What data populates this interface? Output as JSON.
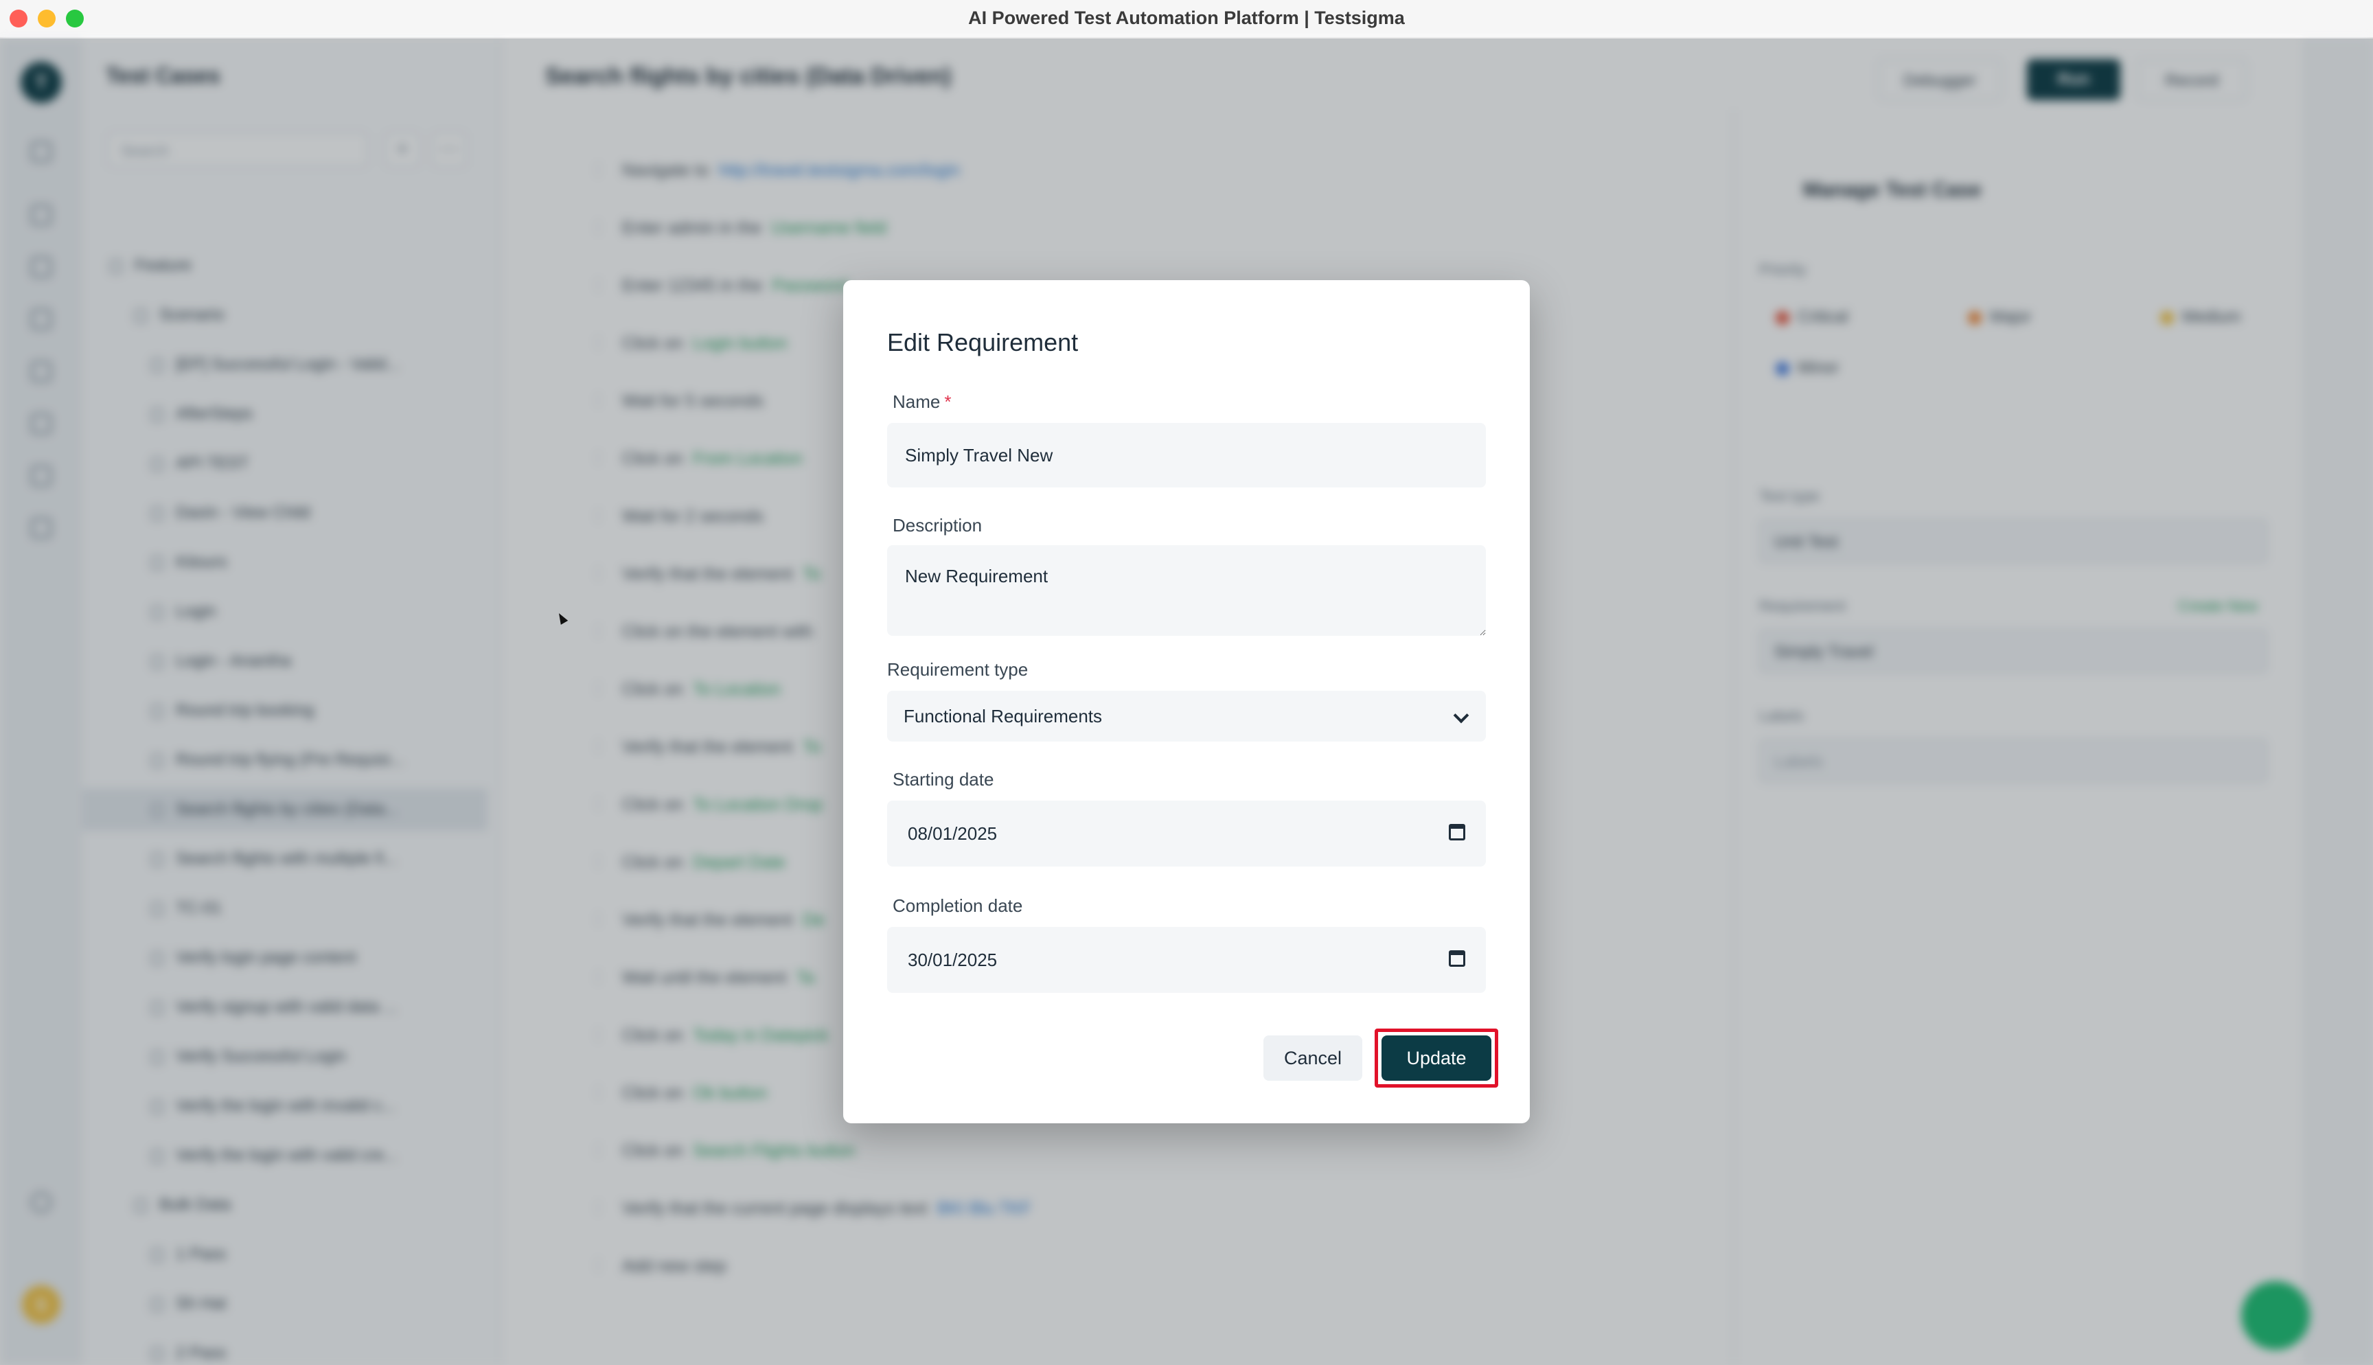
{
  "window": {
    "title": "AI Powered Test Automation Platform | Testsigma"
  },
  "background": {
    "sidebar_title": "Test Cases",
    "search_placeholder": "Search",
    "tree": [
      "Feature",
      "Scenario",
      "[EP] Successful Login - Valid...",
      "AfterSteps",
      "API TEST",
      "Daxin - View Child",
      "Kitours",
      "Login",
      "Login - Anantha",
      "Round trip booking",
      "Round trip flying (Pre Requisi...",
      "Search flights by cities (Data...",
      "Search flights with multiple fi...",
      "TC-01",
      "Verify login page content",
      "Verify signup with valid data ...",
      "Verify Successful Login",
      "Verify the login with invalid c...",
      "Verify the login with valid cre...",
      "Bulk Data",
      "1 Pass",
      "Sh Hat",
      "2 Pass"
    ],
    "main_title": "Search flights by cities (Data Driven)",
    "steps": [
      {
        "pre": "Navigate to",
        "val": "http://travel.testsigma.com/login"
      },
      {
        "pre": "Enter  admin  in the",
        "val": "Username  field"
      },
      {
        "pre": "Enter  12345  in the",
        "val": "Password"
      },
      {
        "pre": "Click on",
        "val": "Login button"
      },
      {
        "pre": "Wait for  5  seconds",
        "val": ""
      },
      {
        "pre": "Click on",
        "val": "From Location"
      },
      {
        "pre": "Wait for  2  seconds",
        "val": ""
      },
      {
        "pre": "Verify that the element",
        "val": "To"
      },
      {
        "pre": "Click on the element with",
        "val": ""
      },
      {
        "pre": "Click on",
        "val": "To Location"
      },
      {
        "pre": "Verify that the element",
        "val": "To"
      },
      {
        "pre": "Click on",
        "val": "To Location Drop"
      },
      {
        "pre": "Click on",
        "val": "Depart Date"
      },
      {
        "pre": "Verify that the element",
        "val": "De"
      },
      {
        "pre": "Wait until the element",
        "val": "Ta"
      },
      {
        "pre": "Click on",
        "val": "Today in Datepick"
      },
      {
        "pre": "Click on",
        "val": "Ok button"
      },
      {
        "pre": "Click on",
        "val": "Search Flights button"
      },
      {
        "pre": "Verify that the current page displays text",
        "val": "BKI Blu TKF"
      },
      {
        "pre": "Add new step",
        "val": ""
      }
    ],
    "toolbar": {
      "debug": "Debugger",
      "run": "Run",
      "record": "Record"
    },
    "right_panel": {
      "title": "Manage Test Case",
      "priority_label": "Priority",
      "priorities": [
        "Critical",
        "Major",
        "Medium",
        "Minor"
      ],
      "test_type_label": "Test type",
      "test_type_value": "Unit Test",
      "requirement_label": "Requirement",
      "create_new": "Create New",
      "requirement_value": "Simply Travel",
      "labels_label": "Labels",
      "labels_placeholder": "Labels"
    },
    "colors": {
      "brand": "#0c3b45",
      "link": "#2b7bd3",
      "green": "#28a060"
    }
  },
  "modal": {
    "title": "Edit Requirement",
    "name_label": "Name",
    "required_mark": "*",
    "name_value": "Simply Travel New",
    "description_label": "Description",
    "description_value": "New Requirement",
    "type_label": "Requirement type",
    "type_value": "Functional Requirements",
    "start_label": "Starting date",
    "start_value": "08/01/2025",
    "completion_label": "Completion date",
    "completion_value": "30/01/2025",
    "cancel_label": "Cancel",
    "update_label": "Update",
    "highlight_color": "#e1122a"
  }
}
